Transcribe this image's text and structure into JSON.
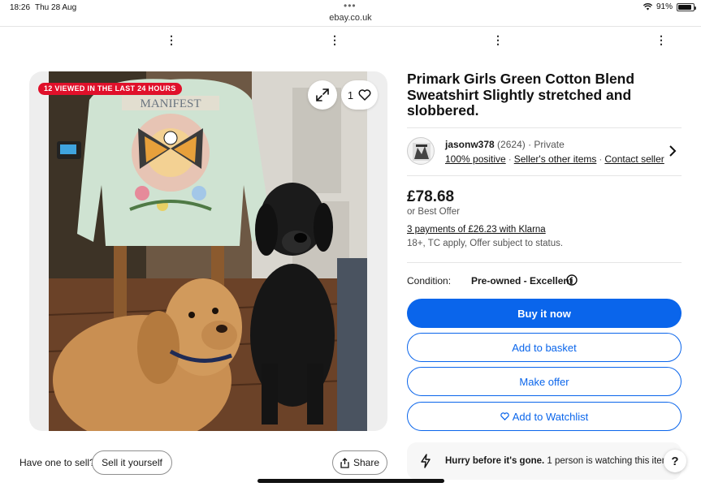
{
  "status_bar": {
    "time": "18:26",
    "date": "Thu 28 Aug",
    "url": "ebay.co.uk",
    "battery_pct": "91%",
    "battery_level": 0.91
  },
  "gallery": {
    "views_badge": "12 VIEWED IN THE LAST 24 HOURS",
    "watch_count": "1",
    "sweatshirt_print": "MANIFEST"
  },
  "listing": {
    "title": "Primark Girls Green Cotton Blend Sweatshirt Slightly stretched and slobbered."
  },
  "seller": {
    "name": "jasonw378",
    "feedback": "(2624)",
    "type": "· Private",
    "positive": "100% positive",
    "other_items": "Seller's other items",
    "contact": "Contact seller"
  },
  "pricing": {
    "price": "£78.68",
    "best_offer": "or Best Offer",
    "klarna": "3 payments of £26.23 with Klarna",
    "klarna_note": "18+, TC apply, Offer subject to status."
  },
  "condition": {
    "label": "Condition:",
    "value": "Pre-owned - Excellent"
  },
  "actions": {
    "buy_now": "Buy it now",
    "add_basket": "Add to basket",
    "make_offer": "Make offer",
    "watchlist": "Add to Watchlist"
  },
  "hurry": {
    "bold": "Hurry before it's gone.",
    "text": " 1 person is watching this item."
  },
  "footer": {
    "have_one": "Have one to sell?",
    "sell_button": "Sell it yourself",
    "share_button": "Share"
  },
  "colors": {
    "primary_blue": "#0a65eb",
    "badge_red": "#e0102a"
  }
}
